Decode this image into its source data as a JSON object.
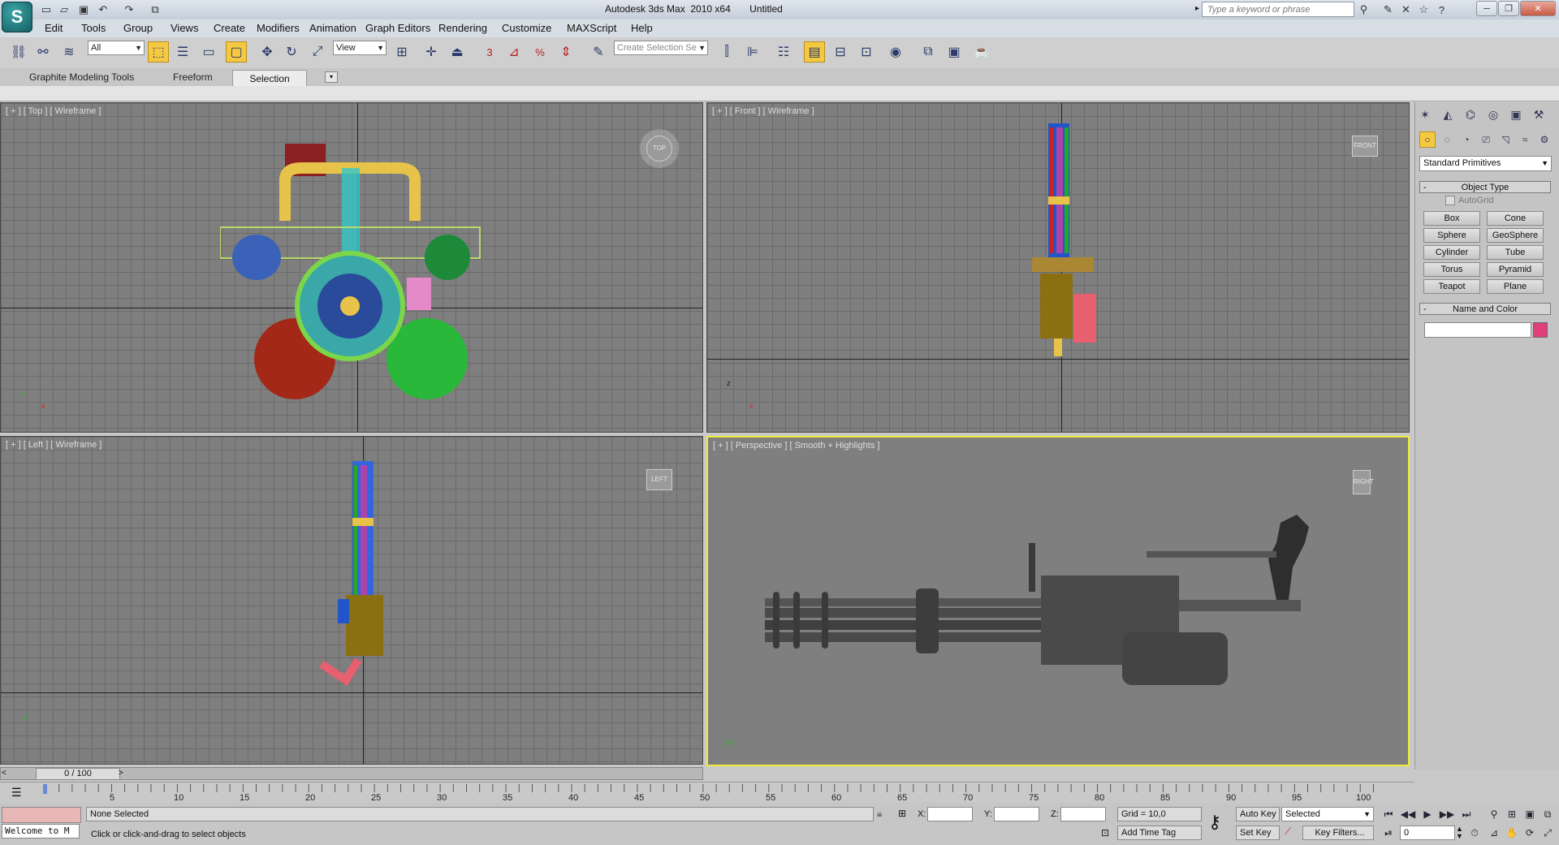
{
  "app": {
    "title": "Autodesk 3ds Max  2010 x64       Untitled",
    "search_placeholder": "Type a keyword or phrase"
  },
  "quick_access": [
    "new-file-icon",
    "open-file-icon",
    "save-icon",
    "undo-icon",
    "redo-icon",
    "project-folder-icon"
  ],
  "menu": [
    "Edit",
    "Tools",
    "Group",
    "Views",
    "Create",
    "Modifiers",
    "Animation",
    "Graph Editors",
    "Rendering",
    "Customize",
    "MAXScript",
    "Help"
  ],
  "toolbar": {
    "selection_filter": "All",
    "reference_coord": "View",
    "named_selection_placeholder": "Create Selection Se",
    "snap_label": "3",
    "angle_snap_label": "%"
  },
  "ribbon": {
    "tabs": [
      "Graphite Modeling Tools",
      "Freeform",
      "Selection"
    ]
  },
  "viewports": [
    {
      "id": "top",
      "label": "[ + ] [ Top ] [ Wireframe ]",
      "cube": "TOP"
    },
    {
      "id": "front",
      "label": "[ + ] [ Front ] [ Wireframe ]",
      "cube": "FRONT"
    },
    {
      "id": "left",
      "label": "[ + ] [ Left ] [ Wireframe ]",
      "cube": "LEFT"
    },
    {
      "id": "perspective",
      "label": "[ + ] [ Perspective ] [ Smooth + Highlights ]",
      "cube": "RIGHT"
    }
  ],
  "command_panel": {
    "category": "Standard Primitives",
    "object_type_title": "Object Type",
    "autogrid": "AutoGrid",
    "buttons": [
      "Box",
      "Cone",
      "Sphere",
      "GeoSphere",
      "Cylinder",
      "Tube",
      "Torus",
      "Pyramid",
      "Teapot",
      "Plane"
    ],
    "name_color_title": "Name and Color",
    "color": "#e0407a"
  },
  "timeline": {
    "frame_display": "0 / 100",
    "ticks": [
      "5",
      "10",
      "15",
      "20",
      "25",
      "30",
      "35",
      "40",
      "45",
      "50",
      "55",
      "60",
      "65",
      "70",
      "75",
      "80",
      "85",
      "90",
      "95",
      "100"
    ]
  },
  "status": {
    "listener": "Welcome to M",
    "selection": "None Selected",
    "prompt": "Click or click-and-drag to select objects",
    "x_label": "X:",
    "y_label": "Y:",
    "z_label": "Z:",
    "grid": "Grid = 10,0",
    "add_time_tag": "Add Time Tag",
    "auto_key": "Auto Key",
    "auto_key_mode": "Selected",
    "set_key": "Set Key",
    "key_filters": "Key Filters...",
    "current_frame": "0"
  },
  "colors": {
    "viewport_bg": "#7f7f7f",
    "active_viewport_border": "#ecec3a",
    "highlight_button": "#f5c842"
  }
}
